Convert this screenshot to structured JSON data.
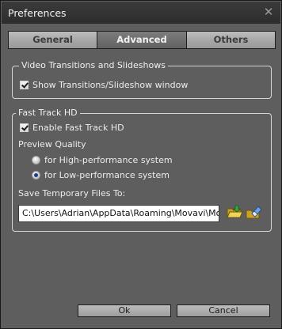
{
  "window": {
    "title": "Preferences",
    "close_icon": "close-icon"
  },
  "tabs": [
    {
      "label": "General",
      "active": false
    },
    {
      "label": "Advanced",
      "active": true
    },
    {
      "label": "Others",
      "active": false
    }
  ],
  "video_transitions": {
    "legend": "Video Transitions and Slideshows",
    "show_window": {
      "label": "Show Transitions/Slideshow window",
      "checked": true
    }
  },
  "fast_track": {
    "legend": "Fast Track HD",
    "enable": {
      "label": "Enable Fast Track HD",
      "checked": true
    },
    "preview_quality_label": "Preview Quality",
    "options": [
      {
        "label": "for High-performance system",
        "selected": false
      },
      {
        "label": "for Low-performance system",
        "selected": true
      }
    ],
    "save_temp_label": "Save Temporary Files To:",
    "save_temp_path": "C:\\Users\\Adrian\\AppData\\Roaming\\Movavi\\MovieE",
    "browse_icon": "folder-browse-icon",
    "clear_icon": "eraser-icon"
  },
  "buttons": {
    "ok": "Ok",
    "cancel": "Cancel"
  }
}
